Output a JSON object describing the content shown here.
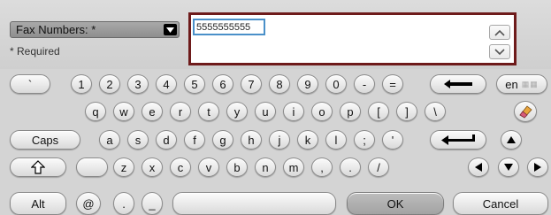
{
  "top": {
    "dropdown_label": "Fax Numbers: *",
    "required_note": "* Required",
    "field_value": "5555555555"
  },
  "keyboard": {
    "row1": [
      "`",
      "1",
      "2",
      "3",
      "4",
      "5",
      "6",
      "7",
      "8",
      "9",
      "0",
      "-",
      "="
    ],
    "lang_label": "en",
    "row2": [
      "q",
      "w",
      "e",
      "r",
      "t",
      "y",
      "u",
      "i",
      "o",
      "p",
      "[",
      "]",
      "\\"
    ],
    "caps_label": "Caps",
    "row3": [
      "a",
      "s",
      "d",
      "f",
      "g",
      "h",
      "j",
      "k",
      "l",
      ";",
      "'"
    ],
    "row4": [
      "z",
      "x",
      "c",
      "v",
      "b",
      "n",
      "m",
      ",",
      ".",
      "/"
    ],
    "alt_label": "Alt",
    "row5": [
      "@",
      ".",
      "_"
    ],
    "ok_label": "OK",
    "cancel_label": "Cancel"
  },
  "icons": {
    "dropdown": "chevron-down-icon",
    "scroll_up": "chevron-up-icon",
    "scroll_down": "chevron-down-icon",
    "backspace": "backspace-arrow-icon",
    "clear": "eraser-icon",
    "enter": "enter-arrow-icon",
    "shift": "shift-arrow-icon",
    "arrows": [
      "arrow-up-icon",
      "arrow-left-icon",
      "arrow-down-icon",
      "arrow-right-icon"
    ]
  },
  "colors": {
    "field_border": "#6e1b1b",
    "input_focus": "#4a90c9"
  }
}
